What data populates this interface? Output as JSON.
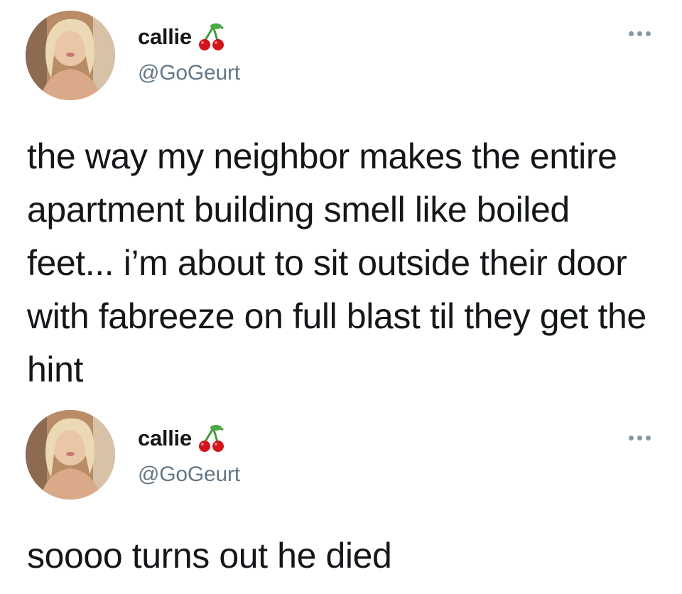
{
  "tweets": [
    {
      "display_name": "callie",
      "handle": "@GoGeurt",
      "text": "the way my neighbor makes the entire apartment building smell like boiled feet... i’m about to sit outside their door with fabreeze on full blast til they get the hint"
    },
    {
      "display_name": "callie",
      "handle": "@GoGeurt",
      "text": "soooo turns out he died"
    }
  ],
  "icons": {
    "name_emoji": "cherry-icon",
    "more": "more-options-icon"
  },
  "colors": {
    "background": "#ffffff",
    "text": "#14171a",
    "handle": "#657786",
    "cherry_red": "#d2141c",
    "cherry_stem": "#3f9b3a"
  }
}
